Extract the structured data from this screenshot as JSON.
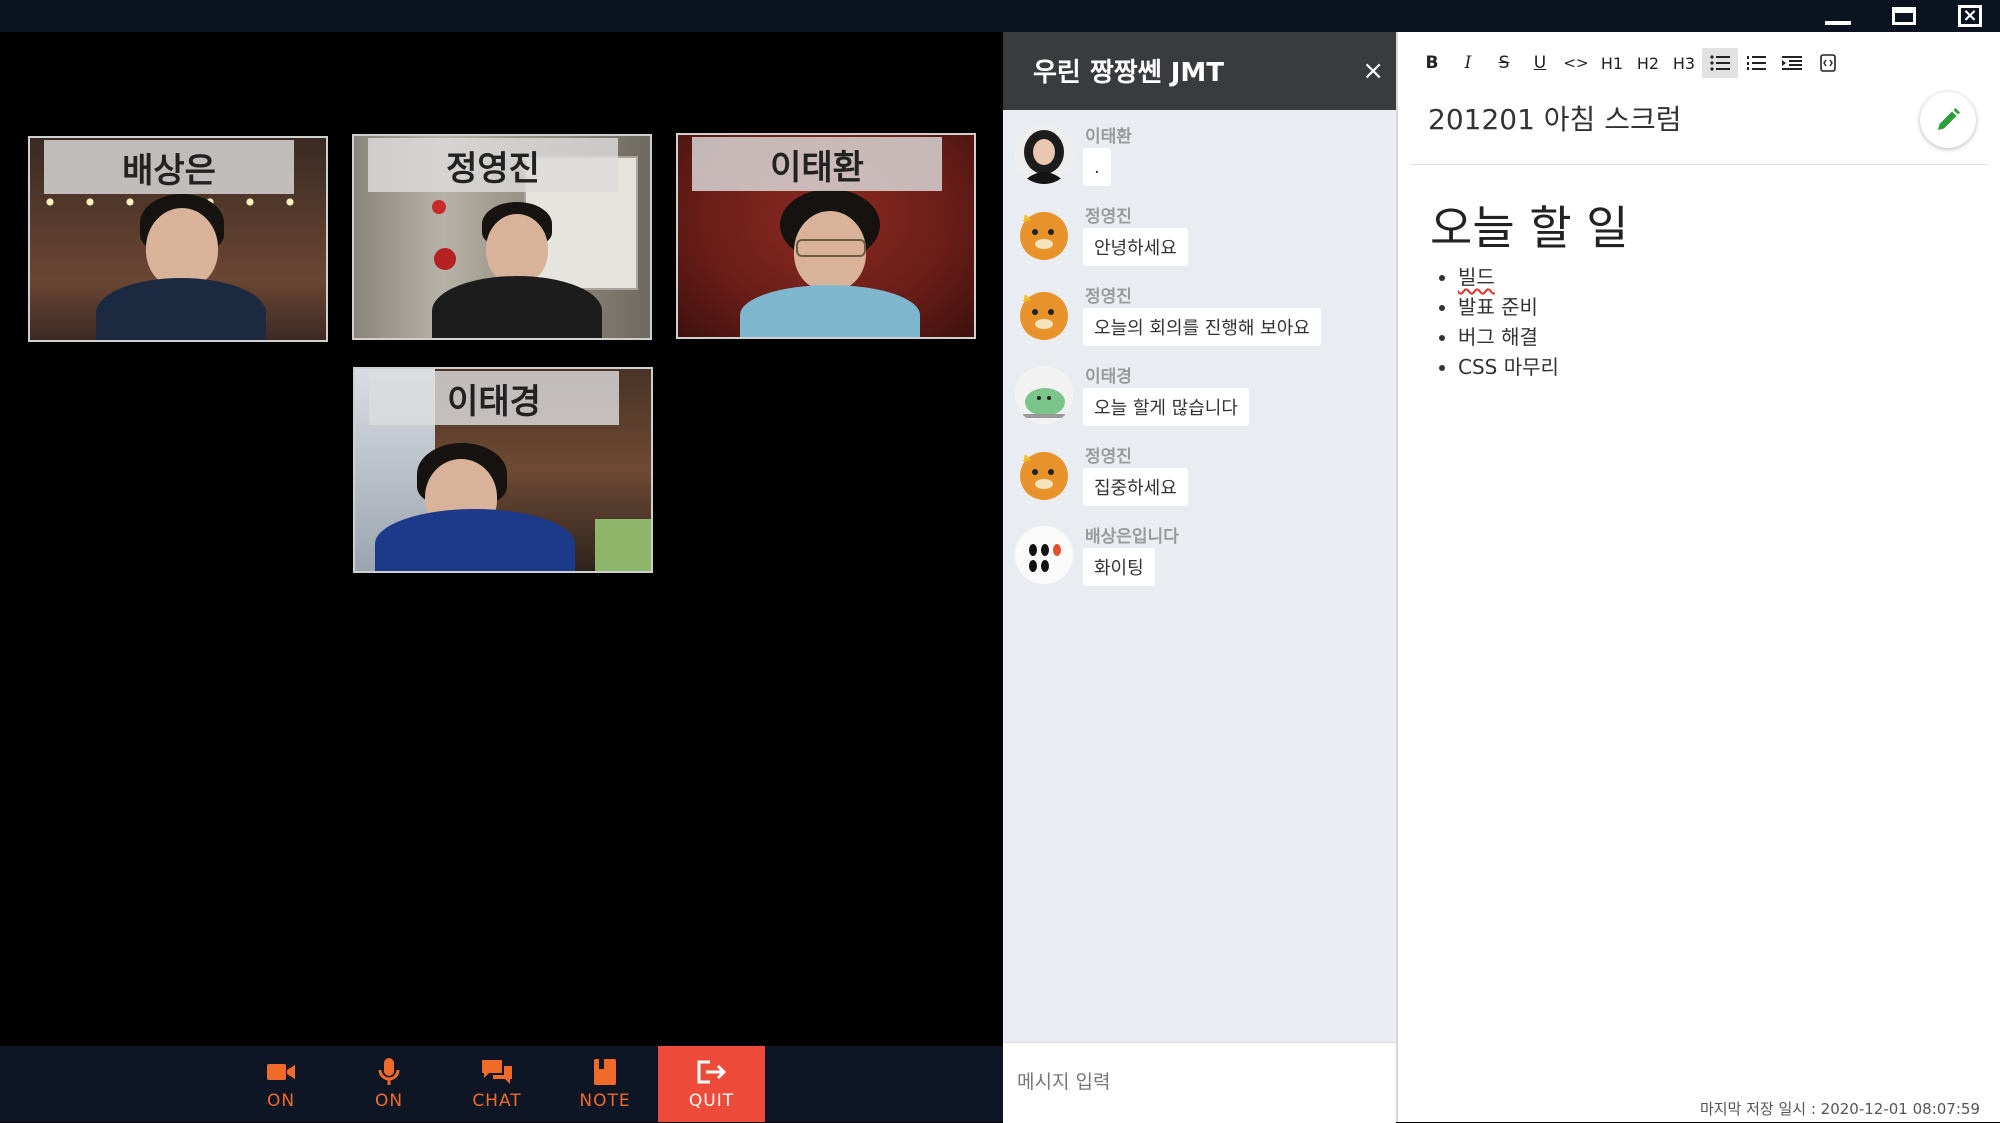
{
  "window": {
    "minimize_label": "",
    "maximize_label": "",
    "close_label": "×"
  },
  "video": {
    "participants": [
      {
        "name": "배상은"
      },
      {
        "name": "정영진"
      },
      {
        "name": "이태환"
      },
      {
        "name": "이태경"
      }
    ]
  },
  "controls": {
    "camera": {
      "label": "ON",
      "icon": "camera-icon"
    },
    "mic": {
      "label": "ON",
      "icon": "microphone-icon"
    },
    "chat": {
      "label": "CHAT",
      "icon": "chat-icon"
    },
    "note": {
      "label": "NOTE",
      "icon": "note-icon"
    },
    "quit": {
      "label": "QUIT",
      "icon": "exit-icon"
    },
    "accent_color": "#f06a2a",
    "quit_color": "#ee4a3a"
  },
  "chat": {
    "title": "우린 짱짱쎈 JMT",
    "close_label": "×",
    "messages": [
      {
        "sender": "이태환",
        "text": "."
      },
      {
        "sender": "정영진",
        "text": "안녕하세요"
      },
      {
        "sender": "정영진",
        "text": "오늘의 회의를 진행해 보아요"
      },
      {
        "sender": "이태경",
        "text": "오늘 할게 많습니다"
      },
      {
        "sender": "정영진",
        "text": "집중하세요"
      },
      {
        "sender": "배상은입니다",
        "text": "화이팅"
      }
    ],
    "input_placeholder": "메시지 입력"
  },
  "note": {
    "toolbar": [
      "B",
      "I",
      "S",
      "U",
      "<>",
      "H1",
      "H2",
      "H3",
      "ul",
      "ol",
      "indent",
      "code"
    ],
    "title": "201201 아침 스크럼",
    "heading": "오늘 할 일",
    "items": [
      "빌드",
      "발표 준비",
      "버그 해결",
      "CSS 마무리"
    ],
    "save_info": "마지막 저장 일시 : 2020-12-01 08:07:59"
  }
}
